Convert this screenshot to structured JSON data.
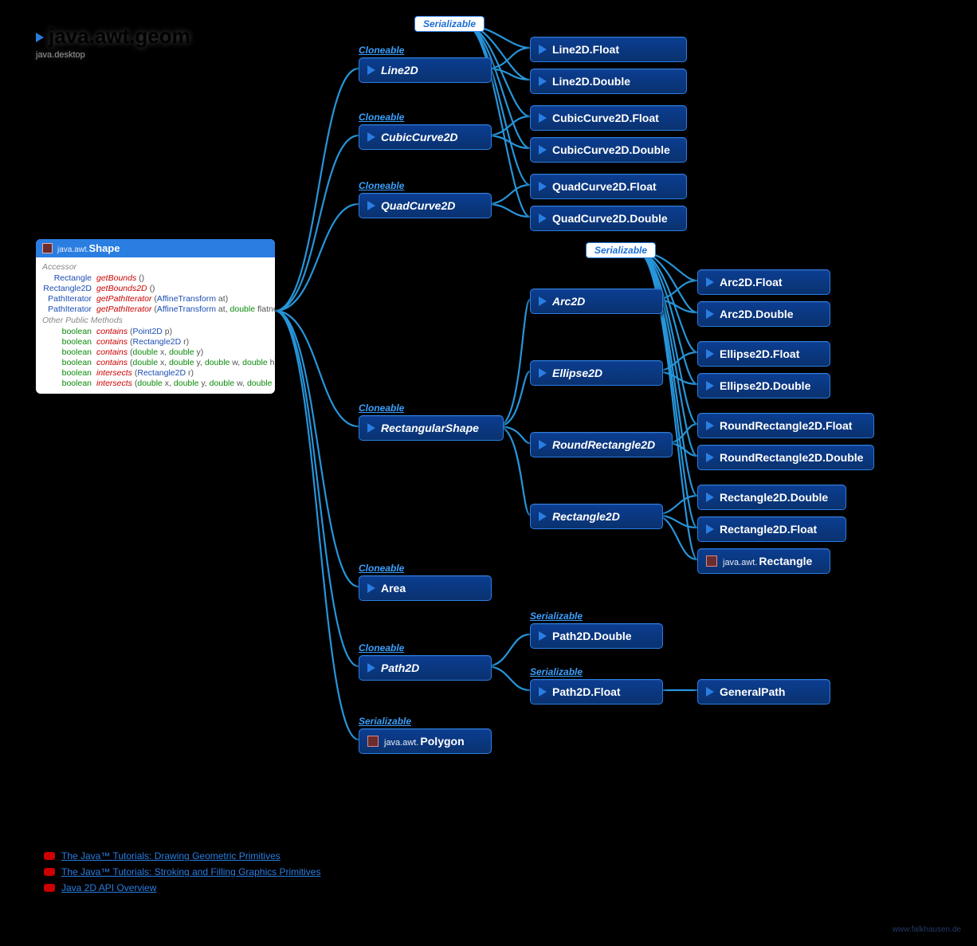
{
  "title": {
    "package": "java.awt.geom",
    "module": "java.desktop"
  },
  "shape_card": {
    "prefix": "java.awt.",
    "name": "Shape",
    "sections": {
      "accessor": "Accessor",
      "other": "Other Public Methods"
    },
    "accessors": [
      {
        "ret": "Rectangle",
        "name": "getBounds",
        "params": "()"
      },
      {
        "ret": "Rectangle2D",
        "name": "getBounds2D",
        "params": "()"
      },
      {
        "ret": "PathIterator",
        "name": "getPathIterator",
        "params_html": "(AffineTransform at)"
      },
      {
        "ret": "PathIterator",
        "name": "getPathIterator",
        "params_html": "(AffineTransform at, double flatness)"
      }
    ],
    "methods": [
      {
        "ret": "boolean",
        "name": "contains",
        "params_html": "(Point2D p)"
      },
      {
        "ret": "boolean",
        "name": "contains",
        "params_html": "(Rectangle2D r)"
      },
      {
        "ret": "boolean",
        "name": "contains",
        "params_html": "(double x, double y)"
      },
      {
        "ret": "boolean",
        "name": "contains",
        "params_html": "(double x, double y, double w, double h)"
      },
      {
        "ret": "boolean",
        "name": "intersects",
        "params_html": "(Rectangle2D r)"
      },
      {
        "ret": "boolean",
        "name": "intersects",
        "params_html": "(double x, double y, double w, double h)"
      }
    ]
  },
  "badges": {
    "serializable_top": "Serializable",
    "serializable_mid": "Serializable"
  },
  "annotations": {
    "cloneable": "Cloneable",
    "serializable": "Serializable"
  },
  "nodes": {
    "Line2D": "Line2D",
    "CubicCurve2D": "CubicCurve2D",
    "QuadCurve2D": "QuadCurve2D",
    "RectangularShape": "RectangularShape",
    "Area": "Area",
    "Path2D": "Path2D",
    "Polygon": "Polygon",
    "Polygon_prefix": "java.awt.",
    "Arc2D": "Arc2D",
    "Ellipse2D": "Ellipse2D",
    "RoundRectangle2D": "RoundRectangle2D",
    "Rectangle2D": "Rectangle2D",
    "Line2D_Float": "Line2D.Float",
    "Line2D_Double": "Line2D.Double",
    "CubicCurve2D_Float": "CubicCurve2D.Float",
    "CubicCurve2D_Double": "CubicCurve2D.Double",
    "QuadCurve2D_Float": "QuadCurve2D.Float",
    "QuadCurve2D_Double": "QuadCurve2D.Double",
    "Arc2D_Float": "Arc2D.Float",
    "Arc2D_Double": "Arc2D.Double",
    "Ellipse2D_Float": "Ellipse2D.Float",
    "Ellipse2D_Double": "Ellipse2D.Double",
    "RoundRectangle2D_Float": "RoundRectangle2D.Float",
    "RoundRectangle2D_Double": "RoundRectangle2D.Double",
    "Rectangle2D_Double": "Rectangle2D.Double",
    "Rectangle2D_Float": "Rectangle2D.Float",
    "Rectangle": "Rectangle",
    "Rectangle_prefix": "java.awt.",
    "Path2D_Double": "Path2D.Double",
    "Path2D_Float": "Path2D.Float",
    "GeneralPath": "GeneralPath"
  },
  "footer": {
    "links": [
      "The Java™ Tutorials: Drawing Geometric Primitives",
      "The Java™ Tutorials: Stroking and Filling Graphics Primitives",
      "Java 2D API Overview"
    ]
  },
  "watermark": "www.falkhausen.de"
}
